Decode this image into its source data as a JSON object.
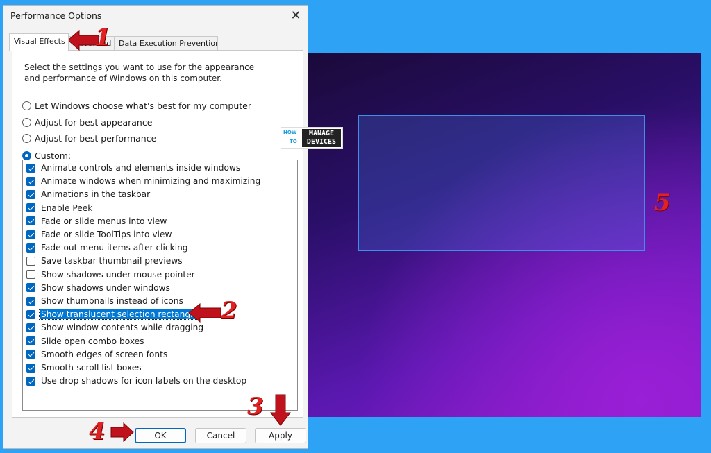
{
  "dialog": {
    "title": "Performance Options",
    "close_icon": "close-icon",
    "tabs": [
      {
        "label": "Visual Effects"
      },
      {
        "label": "Advanced"
      },
      {
        "label": "Data Execution Prevention"
      }
    ],
    "description": "Select the settings you want to use for the appearance and performance of Windows on this computer.",
    "radios": [
      {
        "label": "Let Windows choose what's best for my computer",
        "checked": false
      },
      {
        "label": "Adjust for best appearance",
        "checked": false
      },
      {
        "label": "Adjust for best performance",
        "checked": false
      },
      {
        "label": "Custom:",
        "checked": true
      }
    ],
    "options": [
      {
        "label": "Animate controls and elements inside windows",
        "checked": true
      },
      {
        "label": "Animate windows when minimizing and maximizing",
        "checked": true
      },
      {
        "label": "Animations in the taskbar",
        "checked": true
      },
      {
        "label": "Enable Peek",
        "checked": true
      },
      {
        "label": "Fade or slide menus into view",
        "checked": true
      },
      {
        "label": "Fade or slide ToolTips into view",
        "checked": true
      },
      {
        "label": "Fade out menu items after clicking",
        "checked": true
      },
      {
        "label": "Save taskbar thumbnail previews",
        "checked": false
      },
      {
        "label": "Show shadows under mouse pointer",
        "checked": false
      },
      {
        "label": "Show shadows under windows",
        "checked": true
      },
      {
        "label": "Show thumbnails instead of icons",
        "checked": true
      },
      {
        "label": "Show translucent selection rectangle",
        "checked": true,
        "selected": true
      },
      {
        "label": "Show window contents while dragging",
        "checked": true
      },
      {
        "label": "Slide open combo boxes",
        "checked": true
      },
      {
        "label": "Smooth edges of screen fonts",
        "checked": true
      },
      {
        "label": "Smooth-scroll list boxes",
        "checked": true
      },
      {
        "label": "Use drop shadows for icon labels on the desktop",
        "checked": true
      }
    ],
    "buttons": {
      "ok": "OK",
      "cancel": "Cancel",
      "apply": "Apply"
    }
  },
  "annotations": [
    "1",
    "2",
    "3",
    "4",
    "5"
  ],
  "logo": {
    "line1": "HOW",
    "line2": "TO",
    "line3": "MANAGE",
    "line4": "DEVICES"
  },
  "colors": {
    "accent": "#0067c0",
    "annotation": "#e02222",
    "background": "#2ea3f5"
  }
}
